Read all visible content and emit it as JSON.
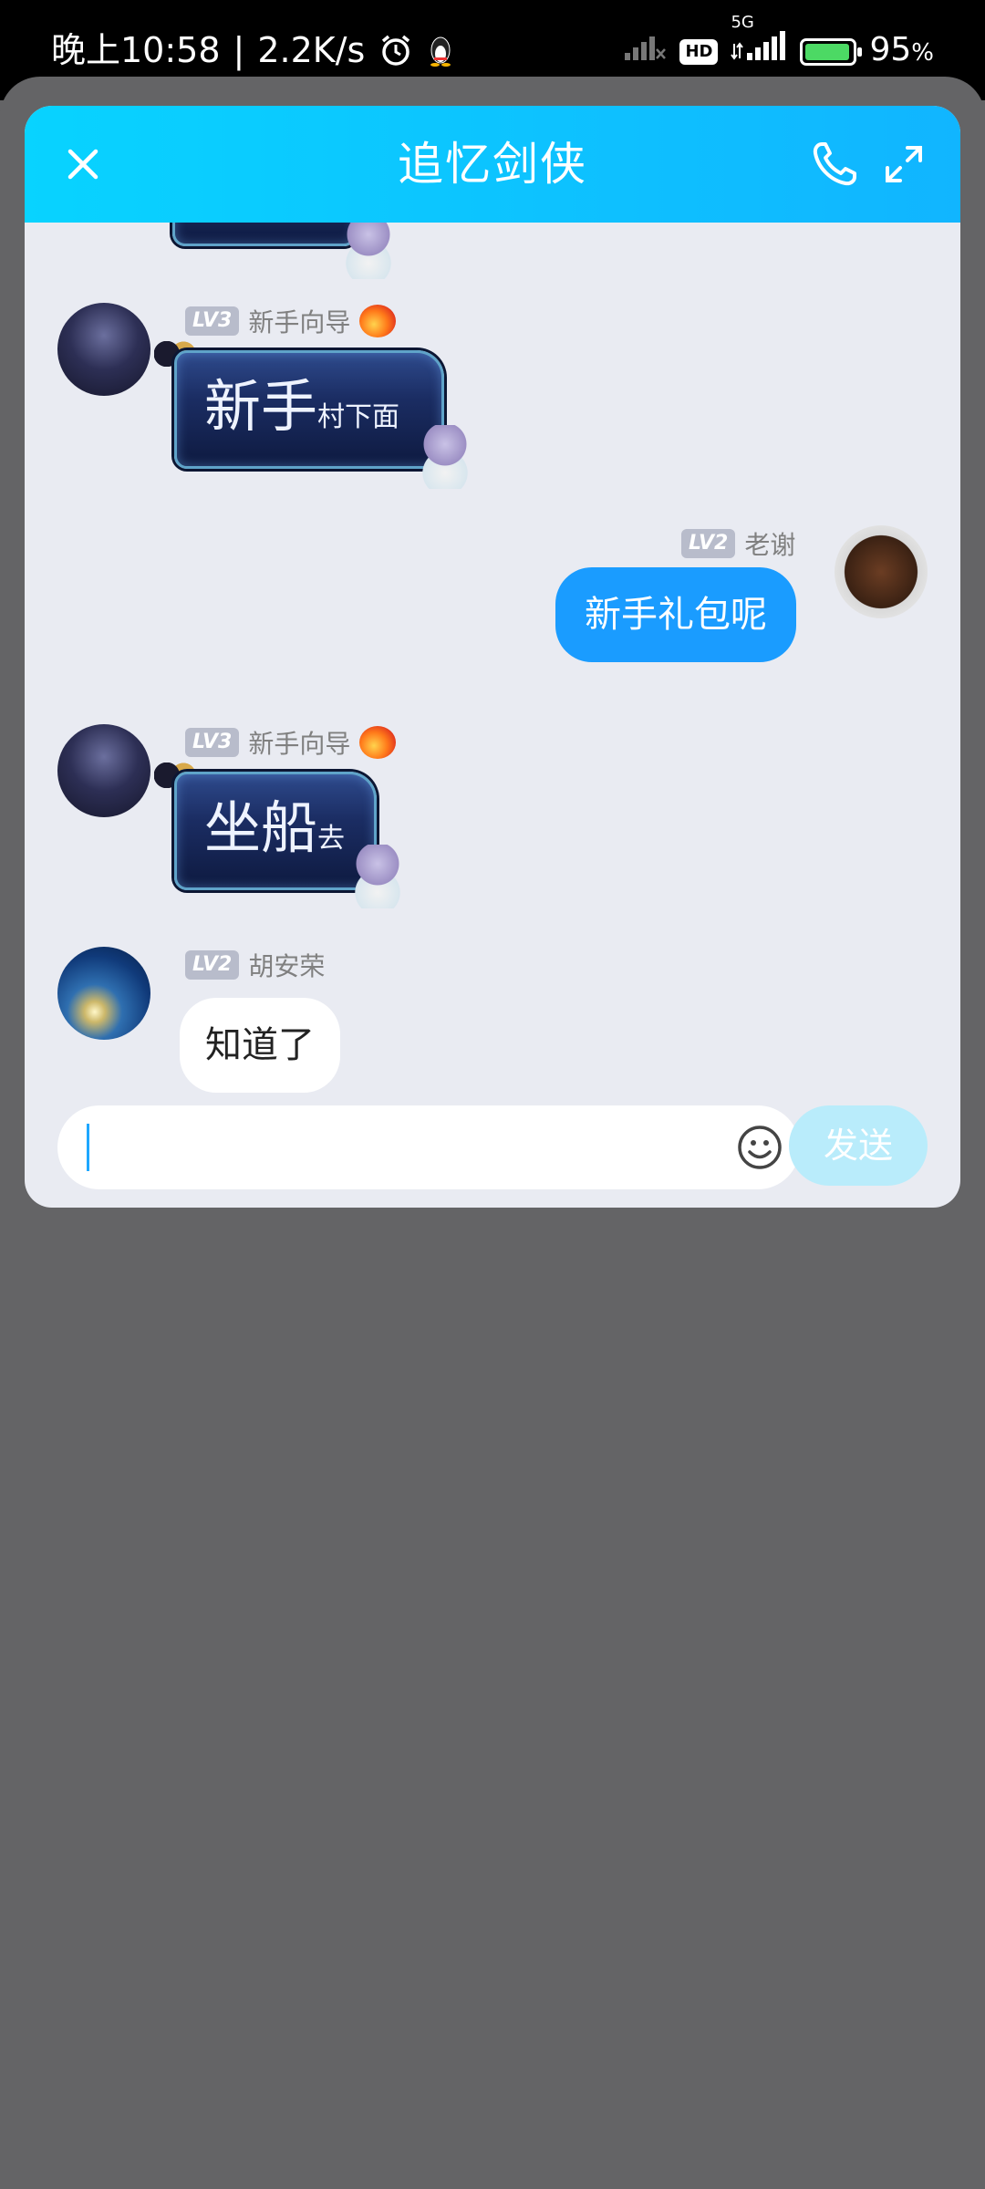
{
  "status_bar": {
    "time": "晚上10:58",
    "separator": "|",
    "speed": "2.2K/s",
    "hd": "HD",
    "network": "5G",
    "battery": "95",
    "battery_unit": "%"
  },
  "header": {
    "title": "追忆剑侠"
  },
  "messages": [
    {
      "sender": "新手向导",
      "level": "LV3",
      "big": "新手",
      "small": "村下面"
    },
    {
      "sender": "老谢",
      "level": "LV2",
      "text": "新手礼包呢"
    },
    {
      "sender": "新手向导",
      "level": "LV3",
      "big": "坐船",
      "small": "去"
    },
    {
      "sender": "胡安荣",
      "level": "LV2",
      "text": "知道了"
    }
  ],
  "input": {
    "send_label": "发送"
  },
  "colors": {
    "header_gradient_start": "#08d3ff",
    "header_gradient_end": "#11b5ff",
    "self_bubble": "#1a9cff",
    "send_button_disabled": "#b9ecfb"
  }
}
